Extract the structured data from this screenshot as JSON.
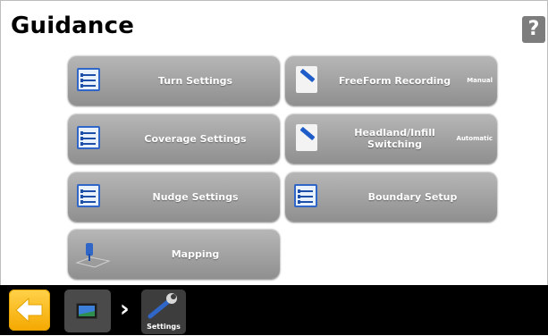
{
  "header": {
    "title": "Guidance",
    "help_label": "?"
  },
  "tiles": [
    {
      "label": "Turn Settings",
      "tag": ""
    },
    {
      "label": "FreeForm Recording",
      "tag": "Manual"
    },
    {
      "label": "Coverage Settings",
      "tag": ""
    },
    {
      "label": "Headland/Infill Switching",
      "tag": "Automatic"
    },
    {
      "label": "Nudge Settings",
      "tag": ""
    },
    {
      "label": "Boundary Setup",
      "tag": ""
    },
    {
      "label": "Mapping",
      "tag": ""
    }
  ],
  "bottom_bar": {
    "separator": "›",
    "current_crumb": "Settings"
  },
  "icons": {
    "list": "list-settings-icon",
    "pen": "pen-recording-icon",
    "map": "map-pin-icon",
    "back": "back-arrow-icon",
    "home": "home-screen-icon",
    "wrench": "wrench-icon"
  },
  "colors": {
    "tile": "#a3a3a3",
    "back_button": "#f5b800",
    "icon_blue": "#2f66c7",
    "bottom_bar": "#000000"
  }
}
